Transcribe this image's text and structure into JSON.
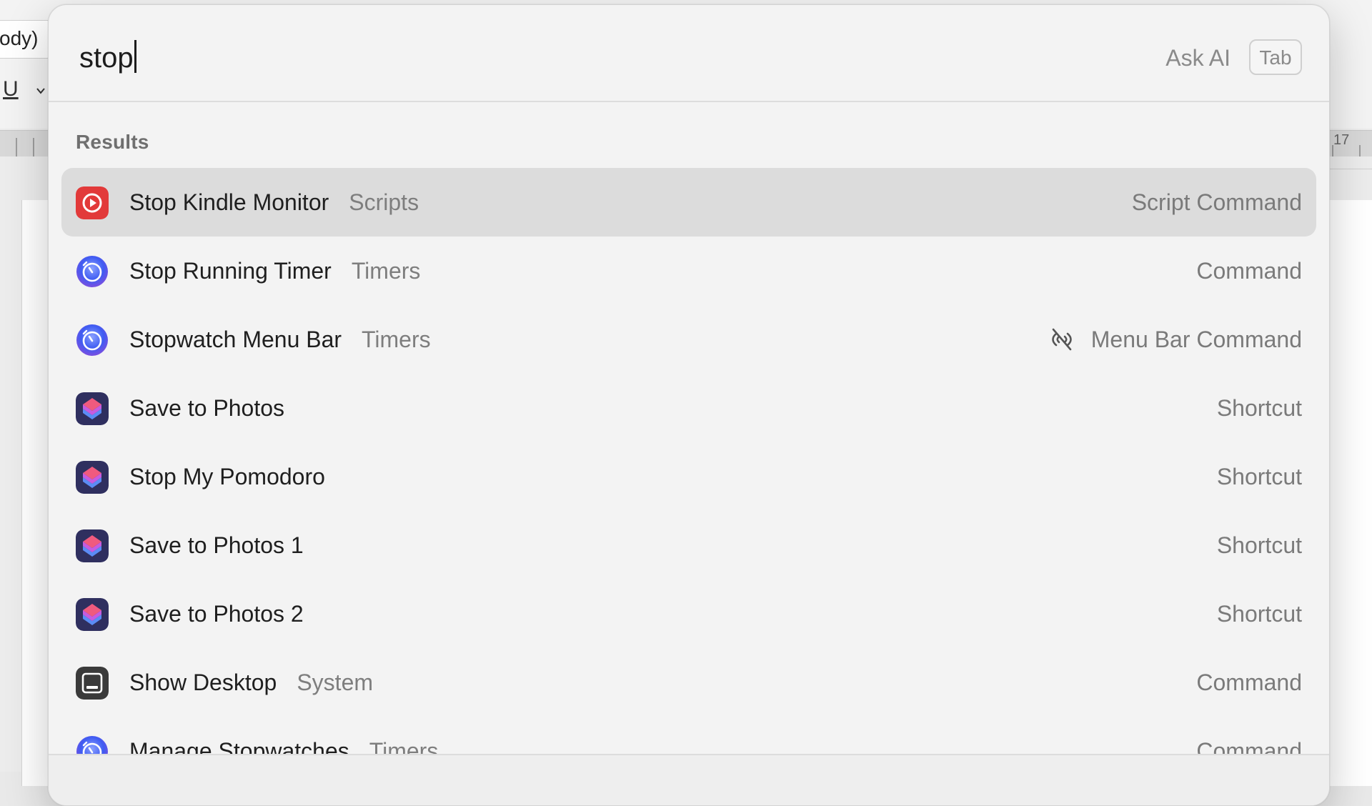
{
  "background_app": {
    "font_field_value": "ody)",
    "underline_label": "U",
    "ruler_number": "17"
  },
  "launcher": {
    "search": {
      "value": "stop",
      "ask_ai_label": "Ask AI",
      "tab_hint": "Tab"
    },
    "section_title": "Results",
    "results": [
      {
        "title": "Stop Kindle Monitor",
        "subtitle": "Scripts",
        "accessory": "Script Command",
        "icon": "script-command-icon",
        "selected": true
      },
      {
        "title": "Stop Running Timer",
        "subtitle": "Timers",
        "accessory": "Command",
        "icon": "timer-icon"
      },
      {
        "title": "Stopwatch Menu Bar",
        "subtitle": "Timers",
        "accessory": "Menu Bar Command",
        "icon": "timer-icon",
        "accessory_icon": "menu-bar-disabled-icon"
      },
      {
        "title": "Save to Photos",
        "subtitle": "",
        "accessory": "Shortcut",
        "icon": "shortcuts-icon"
      },
      {
        "title": "Stop My Pomodoro",
        "subtitle": "",
        "accessory": "Shortcut",
        "icon": "shortcuts-icon"
      },
      {
        "title": "Save to Photos 1",
        "subtitle": "",
        "accessory": "Shortcut",
        "icon": "shortcuts-icon"
      },
      {
        "title": "Save to Photos 2",
        "subtitle": "",
        "accessory": "Shortcut",
        "icon": "shortcuts-icon"
      },
      {
        "title": "Show Desktop",
        "subtitle": "System",
        "accessory": "Command",
        "icon": "show-desktop-icon"
      },
      {
        "title": "Manage Stopwatches",
        "subtitle": "Timers",
        "accessory": "Command",
        "icon": "timer-icon"
      }
    ]
  },
  "colors": {
    "selected_row": "#dcdcdc",
    "script_icon": "#e23a3a",
    "timer_icon": "#3f5cf2",
    "shortcut_icon": "#2b2f5e"
  }
}
